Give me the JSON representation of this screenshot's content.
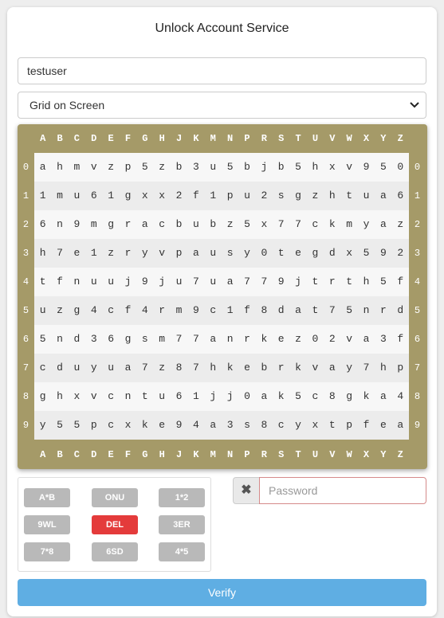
{
  "title": "Unlock Account Service",
  "username": {
    "value": "testuser"
  },
  "mode_select": {
    "selected": "Grid on Screen"
  },
  "grid": {
    "columns": [
      "A",
      "B",
      "C",
      "D",
      "E",
      "F",
      "G",
      "H",
      "J",
      "K",
      "M",
      "N",
      "P",
      "R",
      "S",
      "T",
      "U",
      "V",
      "W",
      "X",
      "Y",
      "Z"
    ],
    "row_labels": [
      "0",
      "1",
      "2",
      "3",
      "4",
      "5",
      "6",
      "7",
      "8",
      "9"
    ],
    "rows": [
      [
        "a",
        "h",
        "m",
        "v",
        "z",
        "p",
        "5",
        "z",
        "b",
        "3",
        "u",
        "5",
        "b",
        "j",
        "b",
        "5",
        "h",
        "x",
        "v",
        "9",
        "5",
        "0"
      ],
      [
        "1",
        "m",
        "u",
        "6",
        "1",
        "g",
        "x",
        "x",
        "2",
        "f",
        "1",
        "p",
        "u",
        "2",
        "s",
        "g",
        "z",
        "h",
        "t",
        "u",
        "a",
        "6"
      ],
      [
        "6",
        "n",
        "9",
        "m",
        "g",
        "r",
        "a",
        "c",
        "b",
        "u",
        "b",
        "z",
        "5",
        "x",
        "7",
        "7",
        "c",
        "k",
        "m",
        "y",
        "a",
        "z"
      ],
      [
        "h",
        "7",
        "e",
        "1",
        "z",
        "r",
        "y",
        "v",
        "p",
        "a",
        "u",
        "s",
        "y",
        "0",
        "t",
        "e",
        "g",
        "d",
        "x",
        "5",
        "9",
        "2"
      ],
      [
        "t",
        "f",
        "n",
        "u",
        "u",
        "j",
        "9",
        "j",
        "u",
        "7",
        "u",
        "a",
        "7",
        "7",
        "9",
        "j",
        "t",
        "r",
        "t",
        "h",
        "5",
        "f"
      ],
      [
        "u",
        "z",
        "g",
        "4",
        "c",
        "f",
        "4",
        "r",
        "m",
        "9",
        "c",
        "1",
        "f",
        "8",
        "d",
        "a",
        "t",
        "7",
        "5",
        "n",
        "r",
        "d"
      ],
      [
        "5",
        "n",
        "d",
        "3",
        "6",
        "g",
        "s",
        "m",
        "7",
        "7",
        "a",
        "n",
        "r",
        "k",
        "e",
        "z",
        "0",
        "2",
        "v",
        "a",
        "3",
        "f"
      ],
      [
        "c",
        "d",
        "u",
        "y",
        "u",
        "a",
        "7",
        "z",
        "8",
        "7",
        "h",
        "k",
        "e",
        "b",
        "r",
        "k",
        "v",
        "a",
        "y",
        "7",
        "h",
        "p"
      ],
      [
        "g",
        "h",
        "x",
        "v",
        "c",
        "n",
        "t",
        "u",
        "6",
        "1",
        "j",
        "j",
        "0",
        "a",
        "k",
        "5",
        "c",
        "8",
        "g",
        "k",
        "a",
        "4"
      ],
      [
        "y",
        "5",
        "5",
        "p",
        "c",
        "x",
        "k",
        "e",
        "9",
        "4",
        "a",
        "3",
        "s",
        "8",
        "c",
        "y",
        "x",
        "t",
        "p",
        "f",
        "e",
        "a"
      ]
    ]
  },
  "keypad": {
    "keys": [
      {
        "label": "A*B"
      },
      {
        "label": "ONU"
      },
      {
        "label": "1*2"
      },
      {
        "label": "9WL"
      },
      {
        "label": "DEL"
      },
      {
        "label": "3ER"
      },
      {
        "label": "7*8"
      },
      {
        "label": "6SD"
      },
      {
        "label": "4*5"
      }
    ]
  },
  "password": {
    "placeholder": "Password",
    "clear_icon": "times-icon"
  },
  "verify_label": "Verify",
  "colors": {
    "grid_frame": "#a59a68",
    "key": "#b9b9b9",
    "key_danger": "#e43b3b",
    "verify": "#5faee3"
  }
}
